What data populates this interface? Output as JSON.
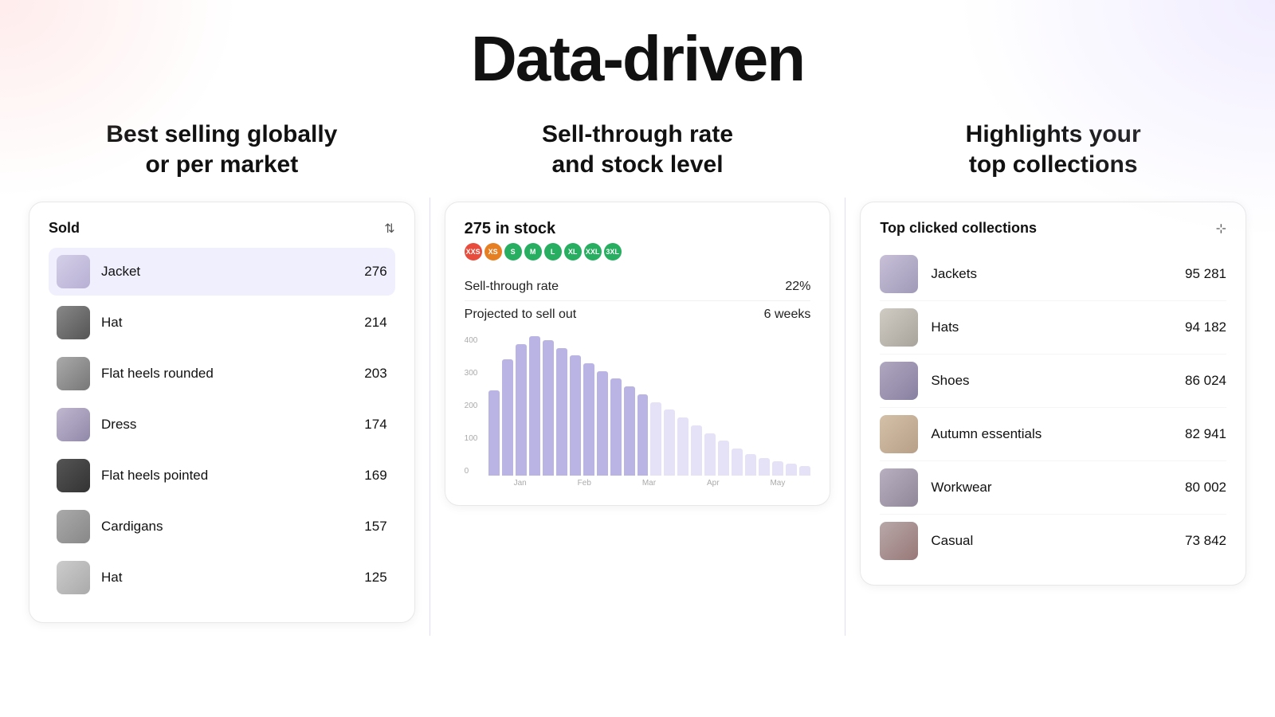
{
  "page": {
    "title": "Data-driven"
  },
  "left": {
    "column_title": "Best selling globally\nor per market",
    "card": {
      "label": "Sold",
      "items": [
        {
          "name": "Jacket",
          "count": "276",
          "active": true,
          "thumb_class": "thumb-jacket"
        },
        {
          "name": "Hat",
          "count": "214",
          "active": false,
          "thumb_class": "thumb-hat"
        },
        {
          "name": "Flat heels rounded",
          "count": "203",
          "active": false,
          "thumb_class": "thumb-flatheels"
        },
        {
          "name": "Dress",
          "count": "174",
          "active": false,
          "thumb_class": "thumb-dress"
        },
        {
          "name": "Flat heels pointed",
          "count": "169",
          "active": false,
          "thumb_class": "thumb-flatheels2"
        },
        {
          "name": "Cardigans",
          "count": "157",
          "active": false,
          "thumb_class": "thumb-cardigans"
        },
        {
          "name": "Hat",
          "count": "125",
          "active": false,
          "thumb_class": "thumb-hat2"
        }
      ]
    }
  },
  "middle": {
    "column_title": "Sell-through rate\nand stock level",
    "card": {
      "stock_label": "275 in stock",
      "size_dots": [
        {
          "label": "XXS",
          "color": "#e74c3c"
        },
        {
          "label": "XS",
          "color": "#e67e22"
        },
        {
          "label": "S",
          "color": "#27ae60"
        },
        {
          "label": "M",
          "color": "#27ae60"
        },
        {
          "label": "L",
          "color": "#27ae60"
        },
        {
          "label": "XL",
          "color": "#27ae60"
        },
        {
          "label": "XXL",
          "color": "#27ae60"
        },
        {
          "label": "3XL",
          "color": "#27ae60"
        }
      ],
      "metrics": [
        {
          "label": "Sell-through rate",
          "value": "22%"
        },
        {
          "label": "Projected to sell out",
          "value": "6 weeks"
        }
      ],
      "chart": {
        "y_labels": [
          "400",
          "300",
          "200",
          "100",
          "0"
        ],
        "x_labels": [
          "Jan",
          "Feb",
          "Mar",
          "Apr",
          "May"
        ],
        "bars": [
          220,
          300,
          340,
          360,
          350,
          330,
          310,
          290,
          270,
          250,
          230,
          210,
          190,
          170,
          150,
          130,
          110,
          90,
          70,
          55,
          45,
          38,
          30,
          25
        ]
      }
    }
  },
  "right": {
    "column_title": "Highlights your\ntop collections",
    "card": {
      "label": "Top clicked collections",
      "collections": [
        {
          "name": "Jackets",
          "count": "95 281",
          "thumb_class": "thumb-jackets"
        },
        {
          "name": "Hats",
          "count": "94 182",
          "thumb_class": "thumb-hats-c"
        },
        {
          "name": "Shoes",
          "count": "86 024",
          "thumb_class": "thumb-shoes-c"
        },
        {
          "name": "Autumn essentials",
          "count": "82 941",
          "thumb_class": "thumb-autumn"
        },
        {
          "name": "Workwear",
          "count": "80 002",
          "thumb_class": "thumb-workwear"
        },
        {
          "name": "Casual",
          "count": "73 842",
          "thumb_class": "thumb-casual"
        }
      ]
    }
  }
}
